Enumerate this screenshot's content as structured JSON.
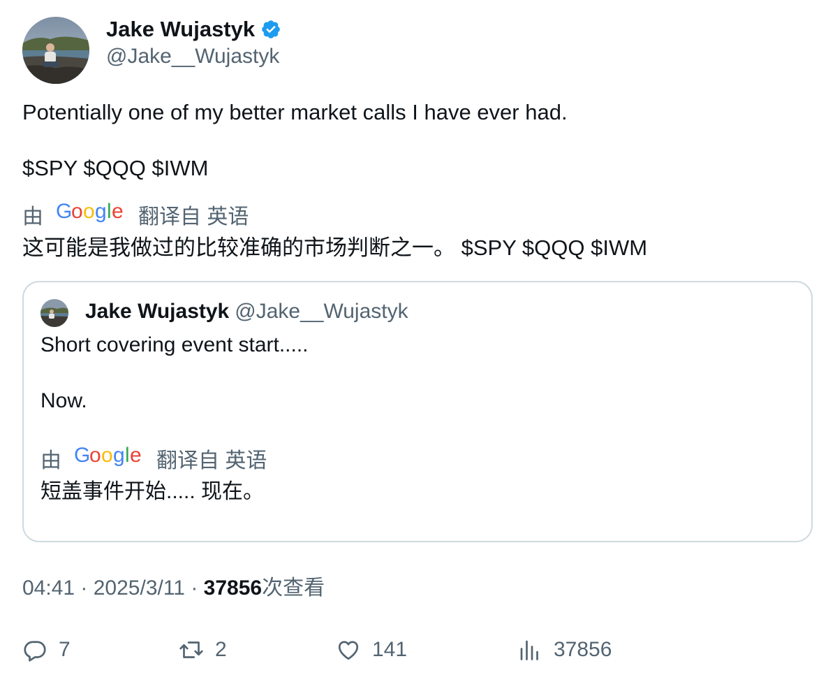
{
  "author": {
    "name": "Jake Wujastyk",
    "handle": "@Jake__Wujastyk",
    "verified": true
  },
  "tweet": {
    "text_line1": "Potentially one of my better market calls I have ever had.",
    "text_line2": "$SPY $QQQ $IWM",
    "translation": {
      "by_label": "由",
      "provider": "Google",
      "translated_from": "翻译自 英语",
      "text": "这可能是我做过的比较准确的市场判断之一。 $SPY $QQQ $IWM"
    }
  },
  "quoted_tweet": {
    "name": "Jake Wujastyk",
    "handle": "@Jake__Wujastyk",
    "text_line1": "Short covering event start.....",
    "text_line2": "Now.",
    "translation": {
      "by_label": "由",
      "provider": "Google",
      "translated_from": "翻译自 英语",
      "text": "短盖事件开始..... 现在。"
    }
  },
  "meta": {
    "time": "04:41",
    "separator": " · ",
    "date": "2025/3/11",
    "views_count": "37856",
    "views_label": "次查看"
  },
  "actions": {
    "replies": "7",
    "retweets": "2",
    "likes": "141",
    "views": "37856"
  },
  "colors": {
    "text_primary": "#0f1419",
    "text_secondary": "#536471",
    "verified_blue": "#1d9bf0",
    "border": "#cfd9de",
    "google_blue": "#4285f4",
    "google_red": "#ea4335",
    "google_yellow": "#fbbc05",
    "google_green": "#34a853"
  }
}
